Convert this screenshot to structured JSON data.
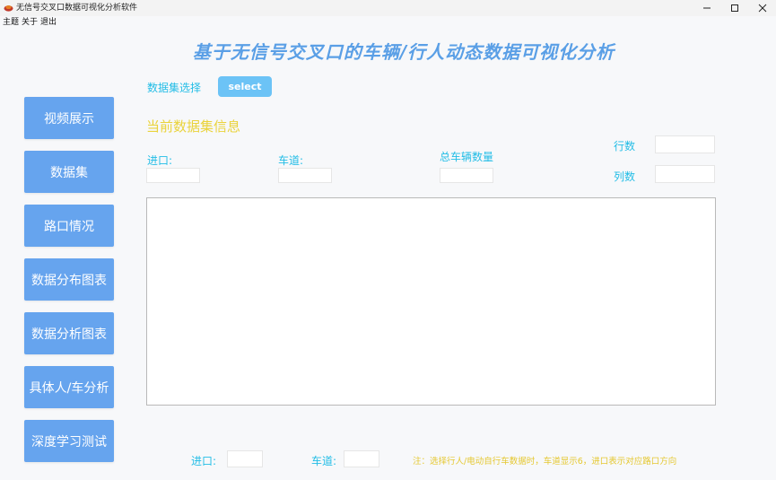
{
  "window": {
    "title": "无信号交叉口数据可视化分析软件",
    "menu": [
      "主题",
      "关于",
      "退出"
    ]
  },
  "header": {
    "title": "基于无信号交叉口的车辆/行人动态数据可视化分析"
  },
  "sidebar": {
    "items": [
      {
        "label": "视频展示"
      },
      {
        "label": "数据集"
      },
      {
        "label": "路口情况"
      },
      {
        "label": "数据分布图表"
      },
      {
        "label": "数据分析图表"
      },
      {
        "label": "具体人/车分析"
      },
      {
        "label": "深度学习测试"
      }
    ]
  },
  "dataset": {
    "select_label": "数据集选择",
    "select_button": "select",
    "info_title": "当前数据集信息",
    "entry_label": "进口:",
    "lane_label": "车道:",
    "total_vehicles_label": "总车辆数量",
    "rows_label": "行数",
    "cols_label": "列数"
  },
  "bottom": {
    "entry_label": "进口:",
    "lane_label": "车道:",
    "note": "注：选择行人/电动自行车数据时，车道显示6，进口表示对应路口方向"
  },
  "colors": {
    "nav_button": "#66a4ee",
    "title_blue": "#5a9fe6",
    "label_cyan": "#23bde6",
    "section_yellow": "#ead33b",
    "note_yellow": "#e5c832"
  }
}
